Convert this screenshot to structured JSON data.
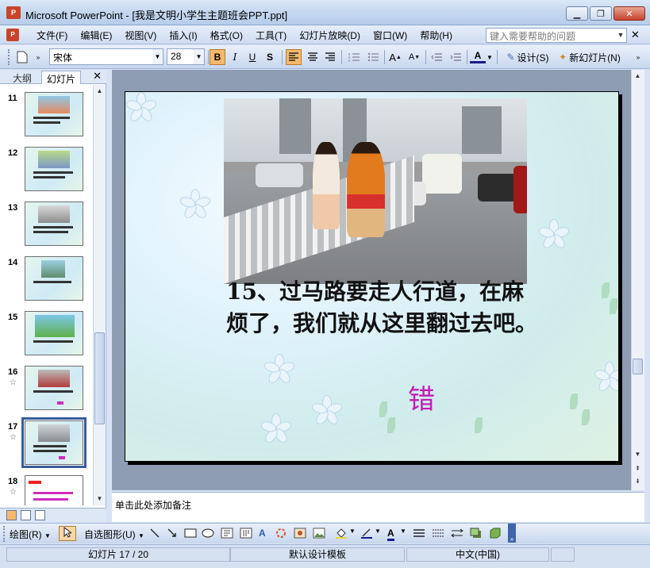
{
  "window": {
    "title": "Microsoft PowerPoint - [我是文明小学生主题班会PPT.ppt]",
    "app_icon_label": "P",
    "minimize": "▁",
    "restore": "❐",
    "close": "✕"
  },
  "menu": {
    "items": [
      "文件(F)",
      "编辑(E)",
      "视图(V)",
      "插入(I)",
      "格式(O)",
      "工具(T)",
      "幻灯片放映(D)",
      "窗口(W)",
      "帮助(H)"
    ],
    "help_placeholder": "键入需要帮助的问题",
    "close": "✕"
  },
  "format_toolbar": {
    "font_name": "宋体",
    "font_size": "28",
    "bold": "B",
    "italic": "I",
    "underline": "U",
    "shadow": "S",
    "design_label": "设计(S)",
    "new_slide_label": "新幻灯片(N)"
  },
  "left_pane": {
    "tab_outline": "大纲",
    "tab_slides": "幻灯片",
    "close": "✕",
    "slides": [
      {
        "num": "11",
        "star": ""
      },
      {
        "num": "12",
        "star": ""
      },
      {
        "num": "13",
        "star": ""
      },
      {
        "num": "14",
        "star": ""
      },
      {
        "num": "15",
        "star": ""
      },
      {
        "num": "16",
        "star": "☆"
      },
      {
        "num": "17",
        "star": "☆"
      },
      {
        "num": "18",
        "star": "☆"
      }
    ],
    "selected_slide": "17"
  },
  "slide": {
    "question": "15、过马路要走人行道，在麻烦了，我们就从这里翻过去吧。",
    "answer": "错",
    "answer_color": "#c21bb2"
  },
  "notes": {
    "placeholder": "单击此处添加备注"
  },
  "draw_toolbar": {
    "draw_label": "绘图(R)",
    "autoshapes_label": "自选图形(U)"
  },
  "status": {
    "slide_position": "幻灯片 17 / 20",
    "template": "默认设计模板",
    "language": "中文(中国)"
  }
}
